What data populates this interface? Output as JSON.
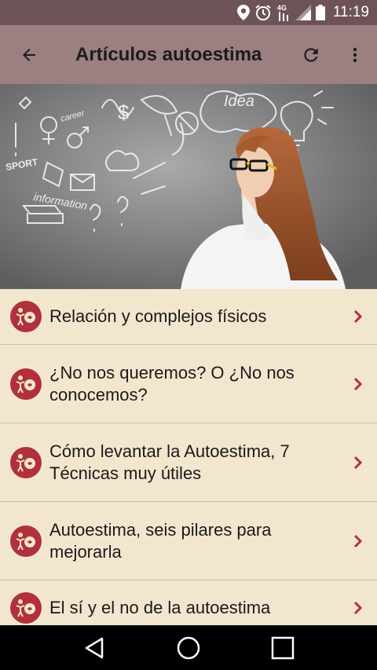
{
  "status_bar": {
    "time": "11:19",
    "network_label": "4G",
    "icons": [
      "location-pin-icon",
      "alarm-clock-icon",
      "signal-4g-icon",
      "signal-bars-icon",
      "battery-icon"
    ]
  },
  "app_bar": {
    "title": "Artículos autoestima",
    "icons": [
      "arrow-back-icon",
      "refresh-icon",
      "more-vertical-icon"
    ]
  },
  "hero": {
    "doodle_texts": [
      "Idea",
      "career",
      "SPORT",
      "information"
    ],
    "image": "woman-thinking-with-chalk-doodles"
  },
  "articles": [
    {
      "title": "Relación y complejos físicos"
    },
    {
      "title": "¿No nos queremos? O ¿No nos conocemos?"
    },
    {
      "title": "Cómo levantar la Autoestima, 7 Técnicas muy útiles"
    },
    {
      "title": "Autoestima, seis pilares para mejorarla"
    },
    {
      "title": "El sí y el no de la autoestima"
    }
  ],
  "colors": {
    "status_bar": "#6e5356",
    "app_bar": "#9c7f80",
    "list_background": "#f3e6cf",
    "avatar": "#b0313b",
    "chevron": "#b0313b",
    "divider": "#c8bfae"
  },
  "nav_bar": {
    "icons": [
      "nav-back-triangle-icon",
      "nav-home-circle-icon",
      "nav-recents-square-icon"
    ]
  }
}
